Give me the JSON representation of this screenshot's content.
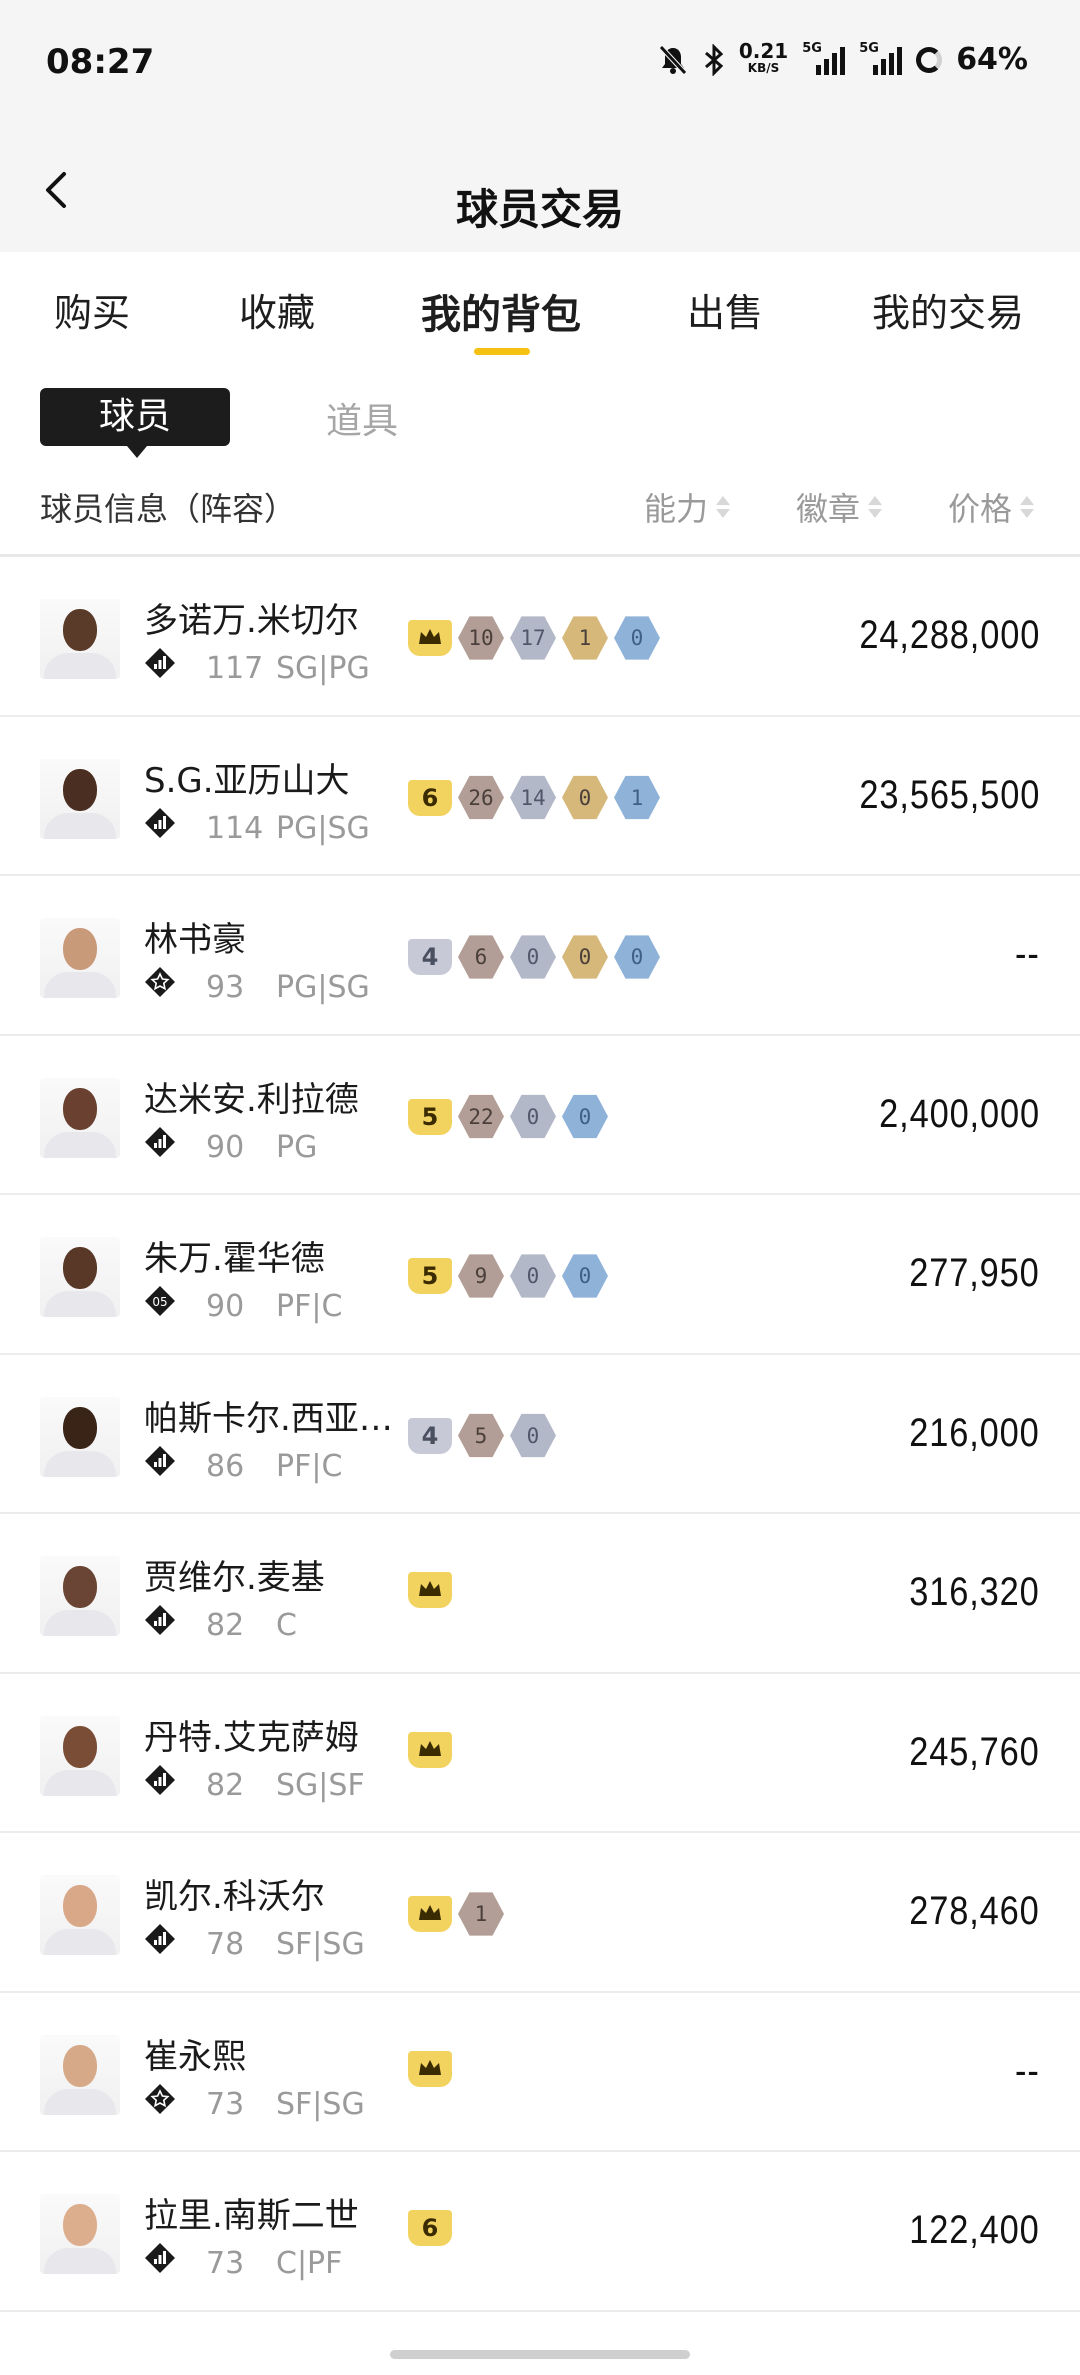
{
  "status": {
    "time": "08:27",
    "net_speed": "0.21",
    "net_unit": "KB/S",
    "net1": "5G",
    "net2": "5G",
    "battery": "64%"
  },
  "nav": {
    "title": "球员交易"
  },
  "tabs": [
    {
      "label": "购买"
    },
    {
      "label": "收藏"
    },
    {
      "label": "我的背包",
      "active": true
    },
    {
      "label": "出售"
    },
    {
      "label": "我的交易"
    }
  ],
  "segment": {
    "players": "球员",
    "items": "道具"
  },
  "header": {
    "info": "球员信息（阵容）",
    "ability": "能力",
    "badge": "徽章",
    "price": "价格"
  },
  "players": [
    {
      "name": "多诺万.米切尔",
      "rating": "117",
      "pos": "SG|PG",
      "tier": "dark",
      "skin": "#5a3a28",
      "level": "crown",
      "badges": [
        [
          "bz",
          "10"
        ],
        [
          "sv",
          "17"
        ],
        [
          "gd",
          "1"
        ],
        [
          "hf",
          "0"
        ]
      ],
      "price": "24,288,000"
    },
    {
      "name": "S.G.亚历山大",
      "rating": "114",
      "pos": "PG|SG",
      "tier": "dark",
      "skin": "#4a2e22",
      "level": "6",
      "badges": [
        [
          "bz",
          "26"
        ],
        [
          "sv",
          "14"
        ],
        [
          "gd",
          "0"
        ],
        [
          "hf",
          "1"
        ]
      ],
      "price": "23,565,500"
    },
    {
      "name": "林书豪",
      "rating": "93",
      "pos": "PG|SG",
      "tier": "star",
      "skin": "#c99a7a",
      "level": "4s",
      "badges": [
        [
          "bz",
          "6"
        ],
        [
          "sv",
          "0"
        ],
        [
          "gd",
          "0"
        ],
        [
          "hf",
          "0"
        ]
      ],
      "price": "--"
    },
    {
      "name": "达米安.利拉德",
      "rating": "90",
      "pos": "PG",
      "tier": "dark",
      "skin": "#6a4030",
      "level": "5",
      "badges": [
        [
          "bz",
          "22"
        ],
        [
          "sv",
          "0"
        ],
        [
          "hf",
          "0"
        ]
      ],
      "price": "2,400,000"
    },
    {
      "name": "朱万.霍华德",
      "rating": "90",
      "pos": "PF|C",
      "tier": "05",
      "skin": "#5a3828",
      "level": "5",
      "badges": [
        [
          "bz",
          "9"
        ],
        [
          "sv",
          "0"
        ],
        [
          "hf",
          "0"
        ]
      ],
      "price": "277,950"
    },
    {
      "name": "帕斯卡尔.西亚卡姆",
      "rating": "86",
      "pos": "PF|C",
      "tier": "dark",
      "skin": "#3a2418",
      "level": "4s",
      "badges": [
        [
          "bz",
          "5"
        ],
        [
          "sv",
          "0"
        ]
      ],
      "price": "216,000"
    },
    {
      "name": "贾维尔.麦基",
      "rating": "82",
      "pos": "C",
      "tier": "dark",
      "skin": "#6a4434",
      "level": "crown",
      "badges": [],
      "price": "316,320"
    },
    {
      "name": "丹特.艾克萨姆",
      "rating": "82",
      "pos": "SG|SF",
      "tier": "dark",
      "skin": "#7a4e36",
      "level": "crown",
      "badges": [],
      "price": "245,760"
    },
    {
      "name": "凯尔.科沃尔",
      "rating": "78",
      "pos": "SF|SG",
      "tier": "dark",
      "skin": "#d8a888",
      "level": "crown",
      "badges": [
        [
          "bz",
          "1"
        ]
      ],
      "price": "278,460"
    },
    {
      "name": "崔永熙",
      "rating": "73",
      "pos": "SF|SG",
      "tier": "star",
      "skin": "#d6aa88",
      "level": "crown",
      "badges": [],
      "price": "--"
    },
    {
      "name": "拉里.南斯二世",
      "rating": "73",
      "pos": "C|PF",
      "tier": "dark",
      "skin": "#dcae8e",
      "level": "6",
      "badges": [],
      "price": "122,400"
    }
  ]
}
